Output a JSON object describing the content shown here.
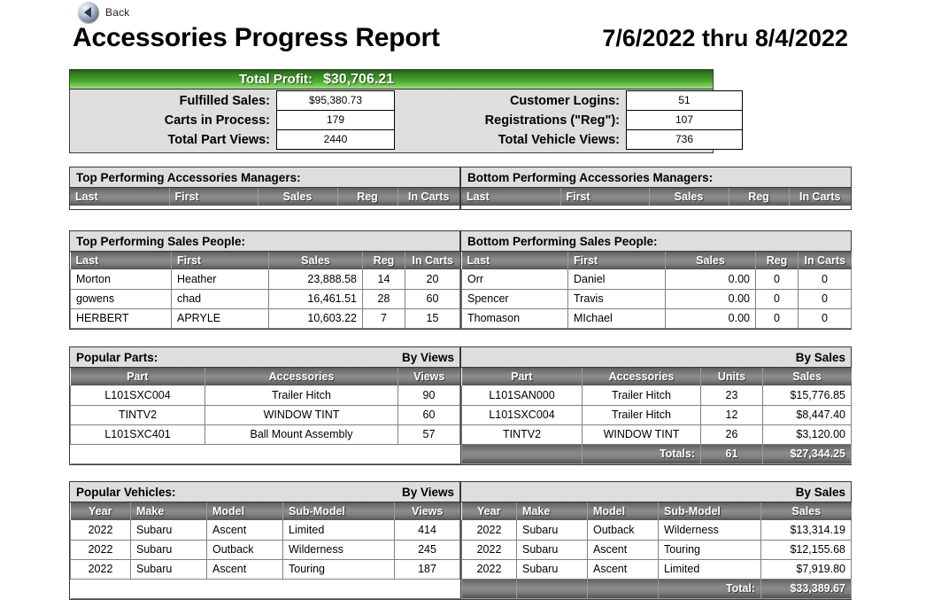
{
  "nav": {
    "back_label": "Back",
    "back_icon": "back-circle-arrow-icon"
  },
  "header": {
    "title": "Accessories Progress Report",
    "date_range": "7/6/2022 thru 8/4/2022"
  },
  "summary": {
    "total_profit_label": "Total Profit:",
    "total_profit_value": "$30,706.21",
    "left": [
      {
        "label": "Fulfilled Sales:",
        "value": "$95,380.73"
      },
      {
        "label": "Carts in Process:",
        "value": "179"
      },
      {
        "label": "Total Part Views:",
        "value": "2440"
      }
    ],
    "right": [
      {
        "label": "Customer Logins:",
        "value": "51"
      },
      {
        "label": "Registrations (\"Reg\"):",
        "value": "107"
      },
      {
        "label": "Total Vehicle Views:",
        "value": "736"
      }
    ]
  },
  "managers": {
    "top": {
      "caption": "Top Performing Accessories Managers:",
      "columns": [
        "Last",
        "First",
        "Sales",
        "Reg",
        "In Carts"
      ],
      "rows": []
    },
    "bottom": {
      "caption": "Bottom Performing Accessories Managers:",
      "columns": [
        "Last",
        "First",
        "Sales",
        "Reg",
        "In Carts"
      ],
      "rows": []
    }
  },
  "salespeople": {
    "top": {
      "caption": "Top Performing Sales People:",
      "columns": [
        "Last",
        "First",
        "Sales",
        "Reg",
        "In Carts"
      ],
      "rows": [
        [
          "Morton",
          "Heather",
          "23,888.58",
          "14",
          "20"
        ],
        [
          "gowens",
          "chad",
          "16,461.51",
          "28",
          "60"
        ],
        [
          "HERBERT",
          "APRYLE",
          "10,603.22",
          "7",
          "15"
        ]
      ]
    },
    "bottom": {
      "caption": "Bottom Performing Sales People:",
      "columns": [
        "Last",
        "First",
        "Sales",
        "Reg",
        "In Carts"
      ],
      "rows": [
        [
          "Orr",
          "Daniel",
          "0.00",
          "0",
          "0"
        ],
        [
          "Spencer",
          "Travis",
          "0.00",
          "0",
          "0"
        ],
        [
          "Thomason",
          "MIchael",
          "0.00",
          "0",
          "0"
        ]
      ]
    }
  },
  "parts": {
    "caption": "Popular Parts:",
    "by_views_label": "By Views",
    "by_sales_label": "By Sales",
    "views": {
      "columns": [
        "Part",
        "Accessories",
        "Views"
      ],
      "rows": [
        [
          "L101SXC004",
          "Trailer Hitch",
          "90"
        ],
        [
          "TINTV2",
          "WINDOW TINT",
          "60"
        ],
        [
          "L101SXC401",
          "Ball Mount Assembly",
          "57"
        ]
      ]
    },
    "sales": {
      "columns": [
        "Part",
        "Accessories",
        "Units",
        "Sales"
      ],
      "rows": [
        [
          "L101SAN000",
          "Trailer Hitch",
          "23",
          "$15,776.85"
        ],
        [
          "L101SXC004",
          "Trailer Hitch",
          "12",
          "$8,447.40"
        ],
        [
          "TINTV2",
          "WINDOW TINT",
          "26",
          "$3,120.00"
        ]
      ],
      "totals_label": "Totals:",
      "totals_units": "61",
      "totals_sales": "$27,344.25"
    }
  },
  "vehicles": {
    "caption": "Popular Vehicles:",
    "by_views_label": "By Views",
    "by_sales_label": "By Sales",
    "views": {
      "columns": [
        "Year",
        "Make",
        "Model",
        "Sub-Model",
        "Views"
      ],
      "rows": [
        [
          "2022",
          "Subaru",
          "Ascent",
          "Limited",
          "414"
        ],
        [
          "2022",
          "Subaru",
          "Outback",
          "Wilderness",
          "245"
        ],
        [
          "2022",
          "Subaru",
          "Ascent",
          "Touring",
          "187"
        ]
      ]
    },
    "sales": {
      "columns": [
        "Year",
        "Make",
        "Model",
        "Sub-Model",
        "Sales"
      ],
      "rows": [
        [
          "2022",
          "Subaru",
          "Outback",
          "Wilderness",
          "$13,314.19"
        ],
        [
          "2022",
          "Subaru",
          "Ascent",
          "Touring",
          "$12,155.68"
        ],
        [
          "2022",
          "Subaru",
          "Ascent",
          "Limited",
          "$7,919.80"
        ]
      ],
      "totals_label": "Total:",
      "totals_sales": "$33,389.67"
    }
  },
  "colors": {
    "profit_bar_green": "#3f9526",
    "table_header_gray": "#8d8d8d",
    "panel_gray": "#dedede"
  }
}
